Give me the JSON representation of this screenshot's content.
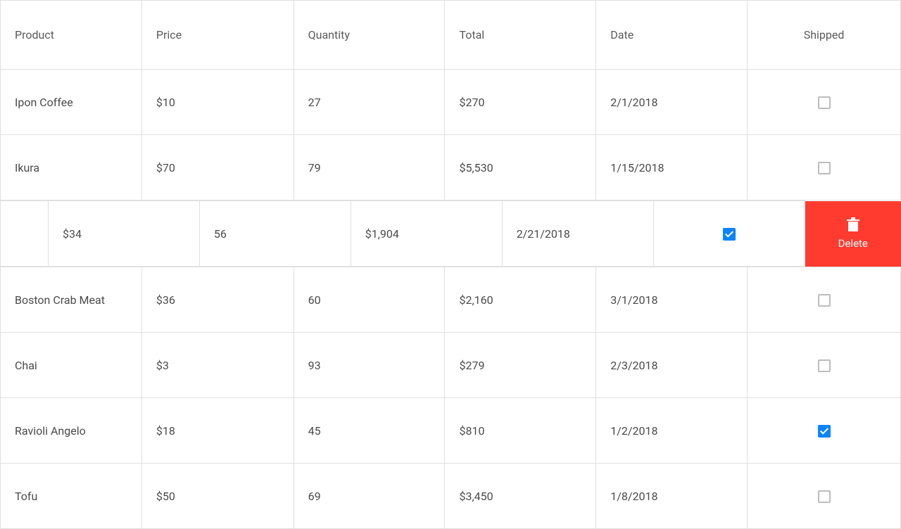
{
  "headers": {
    "product": "Product",
    "price": "Price",
    "quantity": "Quantity",
    "total": "Total",
    "date": "Date",
    "shipped": "Shipped"
  },
  "rows": [
    {
      "product": "Ipon Coffee",
      "price": "$10",
      "quantity": "27",
      "total": "$270",
      "date": "2/1/2018",
      "shipped": false
    },
    {
      "product": "Ikura",
      "price": "$70",
      "quantity": "79",
      "total": "$5,530",
      "date": "1/15/2018",
      "shipped": false
    }
  ],
  "swipedRow": {
    "price": "$34",
    "quantity": "56",
    "total": "$1,904",
    "date": "2/21/2018",
    "shipped": true,
    "deleteLabel": "Delete"
  },
  "rows2": [
    {
      "product": "Boston Crab Meat",
      "price": "$36",
      "quantity": "60",
      "total": "$2,160",
      "date": "3/1/2018",
      "shipped": false
    },
    {
      "product": "Chai",
      "price": "$3",
      "quantity": "93",
      "total": "$279",
      "date": "2/3/2018",
      "shipped": false
    },
    {
      "product": "Ravioli Angelo",
      "price": "$18",
      "quantity": "45",
      "total": "$810",
      "date": "1/2/2018",
      "shipped": true
    },
    {
      "product": "Tofu",
      "price": "$50",
      "quantity": "69",
      "total": "$3,450",
      "date": "1/8/2018",
      "shipped": false
    }
  ]
}
